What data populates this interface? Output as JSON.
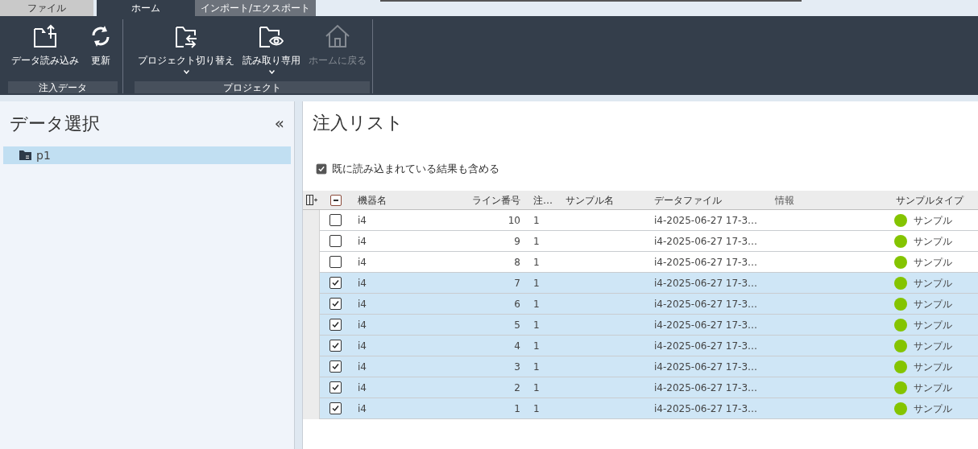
{
  "tabs": [
    {
      "label": "ファイル",
      "selected": false
    },
    {
      "label": "ホーム",
      "selected": true
    },
    {
      "label": "インポート/エクスポート",
      "selected": false
    }
  ],
  "ribbon_groups": [
    {
      "label": "注入データ",
      "buttons": [
        {
          "label": "データ読み込み",
          "dropdown": false,
          "disabled": false
        },
        {
          "label": "更新",
          "dropdown": false,
          "disabled": false
        }
      ]
    },
    {
      "label": "プロジェクト",
      "buttons": [
        {
          "label": "プロジェクト切り替え",
          "dropdown": true,
          "disabled": false
        },
        {
          "label": "読み取り専用",
          "dropdown": true,
          "disabled": false
        },
        {
          "label": "ホームに戻る",
          "dropdown": false,
          "disabled": true
        }
      ]
    }
  ],
  "sidebar": {
    "title": "データ選択",
    "collapse": "«",
    "items": [
      {
        "label": "p1",
        "selected": true
      }
    ]
  },
  "main": {
    "title": "注入リスト",
    "include_checkbox": {
      "label": "既に読み込まれている結果も含める",
      "checked": true
    },
    "table": {
      "header_checkbox": {
        "indeterminate": true
      },
      "columns": [
        "機器名",
        "ライン番号",
        "注…",
        "サンプル名",
        "データファイル",
        "情報",
        "サンプルタイプ"
      ],
      "rows": [
        {
          "checked": false,
          "instrument": "i4",
          "line": "10",
          "injection": "1",
          "data_file": "i4-2025-06-27 17-3…",
          "sample_type": "サンプル"
        },
        {
          "checked": false,
          "instrument": "i4",
          "line": "9",
          "injection": "1",
          "data_file": "i4-2025-06-27 17-3…",
          "sample_type": "サンプル"
        },
        {
          "checked": false,
          "instrument": "i4",
          "line": "8",
          "injection": "1",
          "data_file": "i4-2025-06-27 17-3…",
          "sample_type": "サンプル"
        },
        {
          "checked": true,
          "instrument": "i4",
          "line": "7",
          "injection": "1",
          "data_file": "i4-2025-06-27 17-3…",
          "sample_type": "サンプル"
        },
        {
          "checked": true,
          "instrument": "i4",
          "line": "6",
          "injection": "1",
          "data_file": "i4-2025-06-27 17-3…",
          "sample_type": "サンプル"
        },
        {
          "checked": true,
          "instrument": "i4",
          "line": "5",
          "injection": "1",
          "data_file": "i4-2025-06-27 17-3…",
          "sample_type": "サンプル"
        },
        {
          "checked": true,
          "instrument": "i4",
          "line": "4",
          "injection": "1",
          "data_file": "i4-2025-06-27 17-3…",
          "sample_type": "サンプル"
        },
        {
          "checked": true,
          "instrument": "i4",
          "line": "3",
          "injection": "1",
          "data_file": "i4-2025-06-27 17-3…",
          "sample_type": "サンプル"
        },
        {
          "checked": true,
          "instrument": "i4",
          "line": "2",
          "injection": "1",
          "data_file": "i4-2025-06-27 17-3…",
          "sample_type": "サンプル"
        },
        {
          "checked": true,
          "instrument": "i4",
          "line": "1",
          "injection": "1",
          "data_file": "i4-2025-06-27 17-3…",
          "sample_type": "サンプル"
        }
      ]
    }
  }
}
